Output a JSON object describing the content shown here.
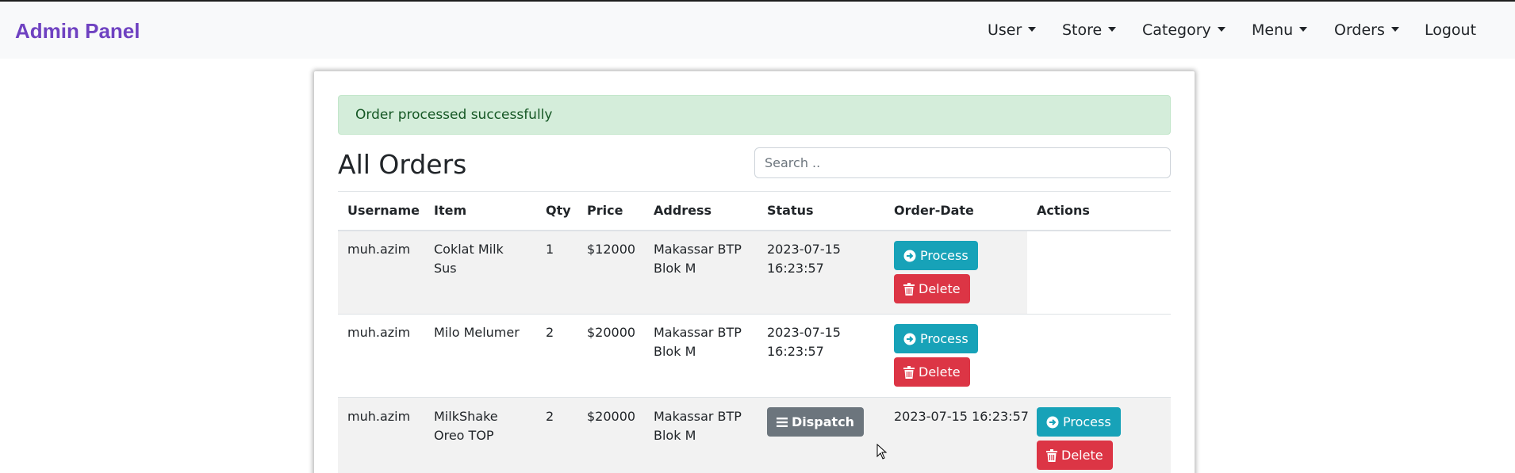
{
  "navbar": {
    "brand": "Admin Panel",
    "items": [
      {
        "label": "User",
        "dropdown": true
      },
      {
        "label": "Store",
        "dropdown": true
      },
      {
        "label": "Category",
        "dropdown": true
      },
      {
        "label": "Menu",
        "dropdown": true
      },
      {
        "label": "Orders",
        "dropdown": true
      },
      {
        "label": "Logout",
        "dropdown": false
      }
    ]
  },
  "alert": {
    "message": "Order processed successfully",
    "color": "#d4edda"
  },
  "page": {
    "title": "All Orders"
  },
  "search": {
    "placeholder": "Search .."
  },
  "table": {
    "headers": [
      "Username",
      "Item",
      "Qty",
      "Price",
      "Address",
      "Status",
      "Order-Date",
      "Actions"
    ],
    "rows": [
      {
        "username": "muh.azim",
        "item_line1": "Coklat Milk",
        "item_line2": "Sus",
        "qty": "1",
        "price": "$12000",
        "address_line1": "Makassar BTP",
        "address_line2": "Blok M",
        "status_line1": "2023-07-15",
        "status_line2": "16:23:57",
        "process_label": "Process",
        "delete_label": "Delete"
      },
      {
        "username": "muh.azim",
        "item_line1": "Milo Melumer",
        "item_line2": "",
        "qty": "2",
        "price": "$20000",
        "address_line1": "Makassar BTP",
        "address_line2": "Blok M",
        "status_line1": "2023-07-15",
        "status_line2": "16:23:57",
        "process_label": "Process",
        "delete_label": "Delete"
      },
      {
        "username": "muh.azim",
        "item_line1": "MilkShake",
        "item_line2": "Oreo TOP",
        "qty": "2",
        "price": "$20000",
        "address_line1": "Makassar BTP",
        "address_line2": "Blok M",
        "dispatch_label": "Dispatch",
        "order_date": "2023-07-15 16:23:57",
        "process_label": "Process",
        "delete_label": "Delete"
      }
    ]
  },
  "colors": {
    "brand": "#6f42c1",
    "process": "#17a2b8",
    "delete": "#dc3545",
    "dispatch": "#6c757d",
    "striped_row": "#f2f2f2"
  }
}
